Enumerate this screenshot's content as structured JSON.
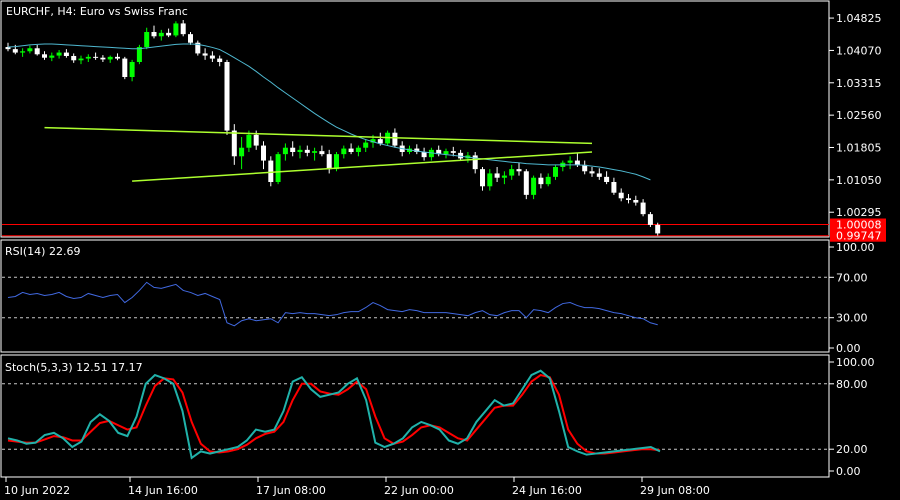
{
  "header": {
    "symbol_label": "EURCHF, H4:  Euro vs Swiss Franc"
  },
  "colors": {
    "background": "#000000",
    "frame": "#ffffff",
    "bull": "#00ff00",
    "bear": "#ffffff",
    "ma": "#4fb8d0",
    "trendline": "#adff2f",
    "hline": "#ff0000",
    "rsi": "#4169e1",
    "stoch_main": "#20b2aa",
    "stoch_signal": "#ff0000"
  },
  "chart_data": [
    {
      "type": "candlestick",
      "name": "price",
      "ylim": [
        0.9974,
        1.052
      ],
      "yticks": [
        "1.04825",
        "1.04070",
        "1.03315",
        "1.02560",
        "1.01805",
        "1.01050",
        "1.00295"
      ],
      "price_tags": [
        "1.00008",
        "0.99747"
      ],
      "candles": [
        [
          1.0415,
          1.0425,
          1.0405,
          1.041
        ],
        [
          1.041,
          1.042,
          1.0398,
          1.0402
        ],
        [
          1.0402,
          1.0412,
          1.0392,
          1.0405
        ],
        [
          1.0405,
          1.0418,
          1.04,
          1.0412
        ],
        [
          1.0412,
          1.042,
          1.0395,
          1.0398
        ],
        [
          1.0398,
          1.0405,
          1.0385,
          1.039
        ],
        [
          1.039,
          1.0402,
          1.0382,
          1.0395
        ],
        [
          1.0395,
          1.0408,
          1.0388,
          1.0402
        ],
        [
          1.0402,
          1.041,
          1.039,
          1.0394
        ],
        [
          1.0394,
          1.04,
          1.0378,
          1.0384
        ],
        [
          1.0384,
          1.0395,
          1.0375,
          1.0388
        ],
        [
          1.0388,
          1.0398,
          1.038,
          1.0392
        ],
        [
          1.0392,
          1.0402,
          1.0385,
          1.039
        ],
        [
          1.039,
          1.0396,
          1.038,
          1.0386
        ],
        [
          1.0386,
          1.0395,
          1.0378,
          1.0392
        ],
        [
          1.0392,
          1.04,
          1.0384,
          1.0388
        ],
        [
          1.0388,
          1.0392,
          1.034,
          1.0345
        ],
        [
          1.0345,
          1.0385,
          1.0335,
          1.038
        ],
        [
          1.038,
          1.042,
          1.0375,
          1.0415
        ],
        [
          1.0415,
          1.046,
          1.041,
          1.045
        ],
        [
          1.045,
          1.0465,
          1.0435,
          1.044
        ],
        [
          1.044,
          1.0455,
          1.043,
          1.0448
        ],
        [
          1.0448,
          1.0458,
          1.0438,
          1.0442
        ],
        [
          1.0442,
          1.0475,
          1.0438,
          1.047
        ],
        [
          1.047,
          1.0478,
          1.044,
          1.0445
        ],
        [
          1.0445,
          1.045,
          1.042,
          1.0425
        ],
        [
          1.0425,
          1.043,
          1.0395,
          1.04
        ],
        [
          1.04,
          1.0412,
          1.0385,
          1.0395
        ],
        [
          1.0395,
          1.0405,
          1.038,
          1.0388
        ],
        [
          1.0388,
          1.0395,
          1.037,
          1.038
        ],
        [
          1.038,
          1.0385,
          1.021,
          1.022
        ],
        [
          1.022,
          1.0235,
          1.014,
          1.016
        ],
        [
          1.016,
          1.0205,
          1.013,
          1.018
        ],
        [
          1.018,
          1.022,
          1.017,
          1.021
        ],
        [
          1.021,
          1.022,
          1.0175,
          1.0185
        ],
        [
          1.0185,
          1.0195,
          1.013,
          1.015
        ],
        [
          1.015,
          1.016,
          1.009,
          1.01
        ],
        [
          1.01,
          1.017,
          1.0095,
          1.0165
        ],
        [
          1.0165,
          1.019,
          1.015,
          1.018
        ],
        [
          1.018,
          1.0195,
          1.016,
          1.017
        ],
        [
          1.017,
          1.0185,
          1.0155,
          1.0175
        ],
        [
          1.0175,
          1.0185,
          1.016,
          1.0168
        ],
        [
          1.0168,
          1.018,
          1.015,
          1.0172
        ],
        [
          1.0172,
          1.0185,
          1.016,
          1.0165
        ],
        [
          1.0165,
          1.0175,
          1.012,
          1.013
        ],
        [
          1.013,
          1.017,
          1.0125,
          1.0165
        ],
        [
          1.0165,
          1.0185,
          1.0155,
          1.0178
        ],
        [
          1.0178,
          1.019,
          1.0165,
          1.017
        ],
        [
          1.017,
          1.0185,
          1.016,
          1.018
        ],
        [
          1.018,
          1.02,
          1.017,
          1.0192
        ],
        [
          1.0192,
          1.021,
          1.018,
          1.02
        ],
        [
          1.02,
          1.0215,
          1.0185,
          1.019
        ],
        [
          1.019,
          1.022,
          1.0185,
          1.0215
        ],
        [
          1.0215,
          1.0225,
          1.018,
          1.0185
        ],
        [
          1.0185,
          1.0195,
          1.016,
          1.017
        ],
        [
          1.017,
          1.0185,
          1.0165,
          1.0178
        ],
        [
          1.0178,
          1.0188,
          1.0165,
          1.017
        ],
        [
          1.017,
          1.018,
          1.015,
          1.0158
        ],
        [
          1.0158,
          1.018,
          1.015,
          1.0175
        ],
        [
          1.0175,
          1.0185,
          1.016,
          1.0165
        ],
        [
          1.0165,
          1.0178,
          1.0155,
          1.0172
        ],
        [
          1.0172,
          1.0182,
          1.016,
          1.0168
        ],
        [
          1.0168,
          1.0175,
          1.015,
          1.0155
        ],
        [
          1.0155,
          1.017,
          1.0145,
          1.0162
        ],
        [
          1.0162,
          1.017,
          1.012,
          1.013
        ],
        [
          1.013,
          1.0135,
          1.008,
          1.009
        ],
        [
          1.009,
          1.013,
          1.008,
          1.012
        ],
        [
          1.012,
          1.0135,
          1.01,
          1.011
        ],
        [
          1.011,
          1.0125,
          1.0095,
          1.0115
        ],
        [
          1.0115,
          1.014,
          1.0105,
          1.013
        ],
        [
          1.013,
          1.0145,
          1.0115,
          1.0125
        ],
        [
          1.0125,
          1.013,
          1.006,
          1.007
        ],
        [
          1.007,
          1.0115,
          1.006,
          1.011
        ],
        [
          1.011,
          1.012,
          1.0085,
          1.0095
        ],
        [
          1.0095,
          1.012,
          1.009,
          1.0112
        ],
        [
          1.0112,
          1.014,
          1.0105,
          1.0135
        ],
        [
          1.0135,
          1.015,
          1.0125,
          1.0145
        ],
        [
          1.0145,
          1.016,
          1.013,
          1.015
        ],
        [
          1.015,
          1.0168,
          1.0135,
          1.014
        ],
        [
          1.014,
          1.015,
          1.0118,
          1.0125
        ],
        [
          1.0125,
          1.0135,
          1.0112,
          1.012
        ],
        [
          1.012,
          1.0132,
          1.0105,
          1.0112
        ],
        [
          1.0112,
          1.0125,
          1.0095,
          1.01
        ],
        [
          1.01,
          1.011,
          1.007,
          1.0075
        ],
        [
          1.0075,
          1.0085,
          1.0055,
          1.0062
        ],
        [
          1.0062,
          1.0072,
          1.005,
          1.0058
        ],
        [
          1.0058,
          1.0068,
          1.0045,
          1.0052
        ],
        [
          1.0052,
          1.006,
          1.002,
          1.0025
        ],
        [
          1.0025,
          1.003,
          0.9995,
          1.0
        ],
        [
          1.0,
          1.0005,
          0.9975,
          0.998
        ]
      ],
      "ma": [
        1.0415,
        1.0416,
        1.0418,
        1.042,
        1.0421,
        1.0422,
        1.0422,
        1.0421,
        1.042,
        1.0419,
        1.0418,
        1.0417,
        1.0416,
        1.0415,
        1.0414,
        1.0413,
        1.0412,
        1.0411,
        1.0411,
        1.0413,
        1.0415,
        1.0417,
        1.0419,
        1.0421,
        1.0422,
        1.0422,
        1.0421,
        1.0418,
        1.0414,
        1.0409,
        1.04,
        1.039,
        1.038,
        1.037,
        1.0358,
        1.0345,
        1.0333,
        1.032,
        1.0308,
        1.0296,
        1.0284,
        1.0272,
        1.026,
        1.0249,
        1.0238,
        1.0228,
        1.022,
        1.0212,
        1.0205,
        1.0199,
        1.0194,
        1.0189,
        1.0185,
        1.0181,
        1.0178,
        1.0175,
        1.0172,
        1.017,
        1.0168,
        1.0166,
        1.0164,
        1.0162,
        1.016,
        1.0158,
        1.0156,
        1.0154,
        1.0152,
        1.015,
        1.0148,
        1.0146,
        1.0145,
        1.0143,
        1.0142,
        1.0141,
        1.014,
        1.014,
        1.014,
        1.014,
        1.014,
        1.0139,
        1.0137,
        1.0135,
        1.0132,
        1.0129,
        1.0126,
        1.0122,
        1.0118,
        1.0112,
        1.0105
      ],
      "trendlines": [
        {
          "from": [
            5,
            1.0227
          ],
          "to": [
            80,
            1.019
          ]
        },
        {
          "from": [
            17,
            1.0102
          ],
          "to": [
            80,
            1.017
          ]
        }
      ],
      "hlines": [
        1.00008,
        0.99747
      ]
    },
    {
      "type": "line",
      "name": "rsi",
      "label": "RSI(14) 22.69",
      "ylim": [
        0,
        100
      ],
      "yticks": [
        "100.00",
        "70.00",
        "30.00",
        "0.00"
      ],
      "levels": [
        70,
        30
      ],
      "values": [
        50,
        51,
        55,
        53,
        54,
        52,
        53,
        55,
        51,
        49,
        50,
        54,
        52,
        50,
        52,
        53,
        45,
        50,
        57,
        65,
        60,
        59,
        61,
        63,
        57,
        55,
        52,
        54,
        51,
        48,
        25,
        22,
        27,
        29,
        27,
        28,
        29,
        25,
        35,
        34,
        35,
        34,
        34,
        33,
        32,
        33,
        35,
        36,
        36,
        40,
        45,
        42,
        38,
        37,
        36,
        38,
        37,
        35,
        35,
        35,
        35,
        34,
        33,
        32,
        35,
        37,
        33,
        32,
        35,
        37,
        37,
        30,
        38,
        37,
        35,
        40,
        44,
        45,
        42,
        40,
        40,
        39,
        37,
        35,
        34,
        32,
        30,
        29,
        25,
        23
      ]
    },
    {
      "type": "line",
      "name": "stoch",
      "label": "Stoch(5,3,3) 12.51 17.17",
      "ylim": [
        0,
        100
      ],
      "yticks": [
        "100.00",
        "80.00",
        "20.00",
        "0.00"
      ],
      "levels": [
        80,
        20
      ],
      "main": [
        30,
        28,
        25,
        26,
        33,
        35,
        30,
        22,
        27,
        45,
        52,
        46,
        35,
        32,
        50,
        80,
        88,
        85,
        80,
        55,
        12,
        18,
        16,
        18,
        20,
        22,
        28,
        38,
        36,
        38,
        55,
        82,
        86,
        75,
        68,
        70,
        72,
        80,
        85,
        65,
        26,
        22,
        25,
        30,
        40,
        45,
        42,
        38,
        28,
        25,
        30,
        45,
        55,
        65,
        60,
        62,
        75,
        88,
        92,
        85,
        55,
        22,
        18,
        15,
        16,
        17,
        18,
        19,
        20,
        21,
        22,
        18
      ],
      "signal": [
        28,
        27,
        26,
        26,
        29,
        32,
        31,
        28,
        28,
        36,
        44,
        46,
        42,
        38,
        40,
        60,
        78,
        85,
        84,
        72,
        45,
        25,
        18,
        17,
        18,
        20,
        24,
        30,
        34,
        36,
        45,
        65,
        80,
        80,
        73,
        71,
        70,
        75,
        82,
        75,
        50,
        30,
        25,
        27,
        33,
        40,
        42,
        40,
        35,
        30,
        28,
        38,
        48,
        58,
        60,
        60,
        70,
        82,
        88,
        86,
        70,
        38,
        25,
        18,
        16,
        16,
        17,
        18,
        19,
        20,
        20,
        19
      ]
    }
  ],
  "x_axis": {
    "tick_labels": [
      "10 Jun 2022",
      "14 Jun 16:00",
      "17 Jun 08:00",
      "22 Jun 00:00",
      "24 Jun 16:00",
      "29 Jun 08:00"
    ]
  }
}
